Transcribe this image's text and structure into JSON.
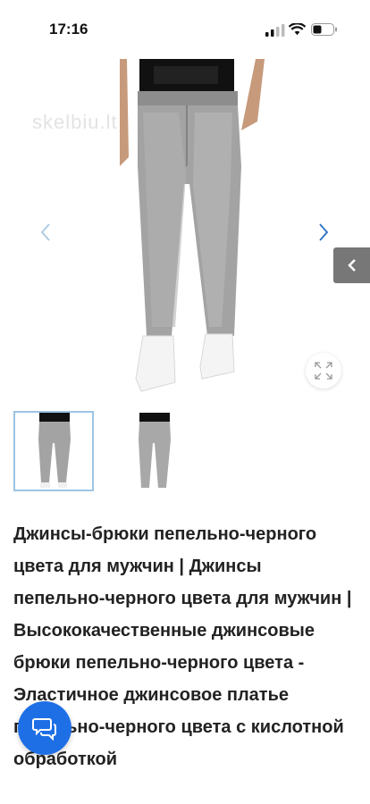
{
  "status_bar": {
    "time": "17:16"
  },
  "watermark": "skelbiu.lt",
  "gallery": {
    "image": "product-jeans-photo",
    "thumbnail_count": 2,
    "selected_thumbnail": 1
  },
  "product": {
    "title": "Джинсы-брюки пепельно-черного цвета для мужчин | Джинсы пепельно-черного цвета для мужчин | Высококачественные джинсовые брюки пепельно-черного цвета - Эластичное джинсовое платье пепельно-черного цвета с кислотной обработкой"
  },
  "colors": {
    "accent": "#1e6fe6",
    "thumb_border": "#9cc4e4",
    "side_tab": "#777777"
  }
}
